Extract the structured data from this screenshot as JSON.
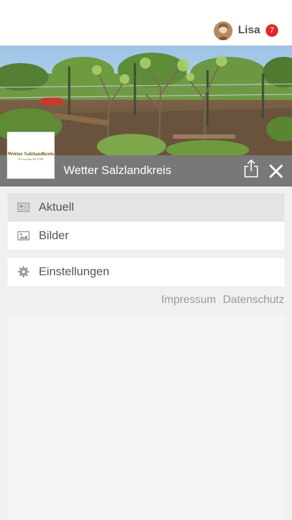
{
  "header": {
    "username": "Lisa",
    "notifications_count": "7"
  },
  "site": {
    "title": "Wetter Salzlandkreis",
    "logo": {
      "title": "Wetter Salzlandkreis",
      "subtitle": "Wir machen WETTER"
    }
  },
  "menu": {
    "items": [
      {
        "label": "Aktuell",
        "icon": "newspaper-icon",
        "active": true
      },
      {
        "label": "Bilder",
        "icon": "image-icon",
        "active": false
      }
    ],
    "settings": {
      "label": "Einstellungen",
      "icon": "gear-icon"
    }
  },
  "footer": {
    "impressum": "Impressum",
    "datenschutz": "Datenschutz"
  },
  "colors": {
    "badge": "#e0262e",
    "titlebar": "#787878",
    "active_item": "#e4e4e4"
  }
}
